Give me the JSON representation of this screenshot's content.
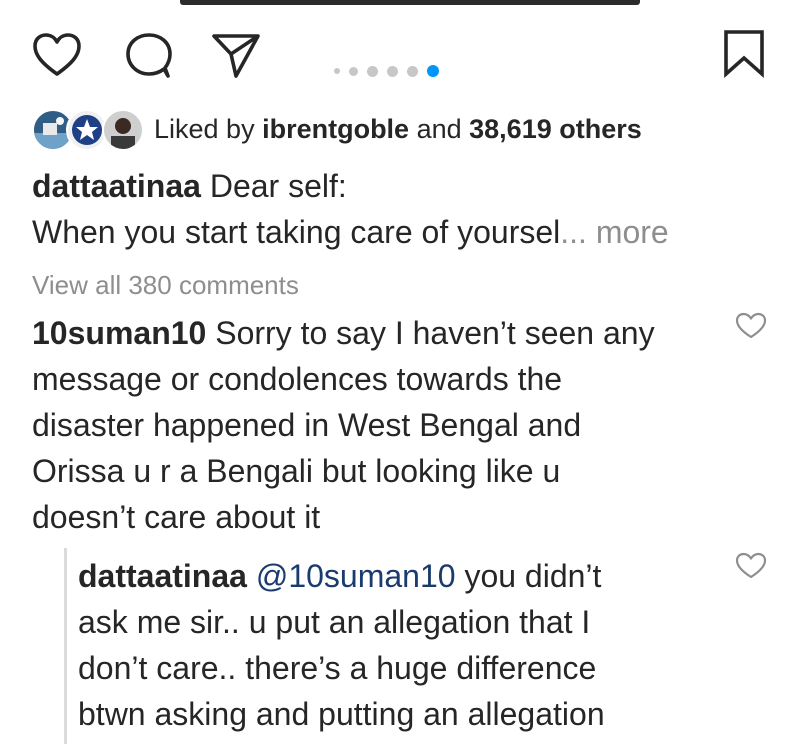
{
  "actions": {
    "icons": [
      "heart-icon",
      "comment-icon",
      "share-icon",
      "bookmark-icon"
    ],
    "carousel": {
      "count": 6,
      "active_index": 5
    }
  },
  "likes": {
    "prefix": "Liked by ",
    "user": "ibrentgoble",
    "joiner": " and ",
    "others": "38,619 others"
  },
  "caption": {
    "user": "dattaatinaa",
    "line1": " Dear self:",
    "line2": "When you start taking care of yoursel",
    "more": "... more"
  },
  "view_all": "View all 380 comments",
  "comments": [
    {
      "user": "10suman10",
      "lines": [
        " Sorry to say I haven’t seen any",
        "message or condolences towards the",
        "disaster happened in West Bengal and",
        "Orissa u r a Bengali but looking like u",
        "doesn’t care about it"
      ]
    }
  ],
  "reply": {
    "user": "dattaatinaa",
    "mention": "@10suman10",
    "lines": [
      " you didn’t",
      "ask me sir.. u put an allegation that I",
      "don’t care.. there’s a huge difference",
      "btwn asking and putting an allegation"
    ]
  },
  "colors": {
    "text": "#262626",
    "muted": "#8e8e8e",
    "active_dot": "#0095f6",
    "mention": "#1a3b6e"
  }
}
